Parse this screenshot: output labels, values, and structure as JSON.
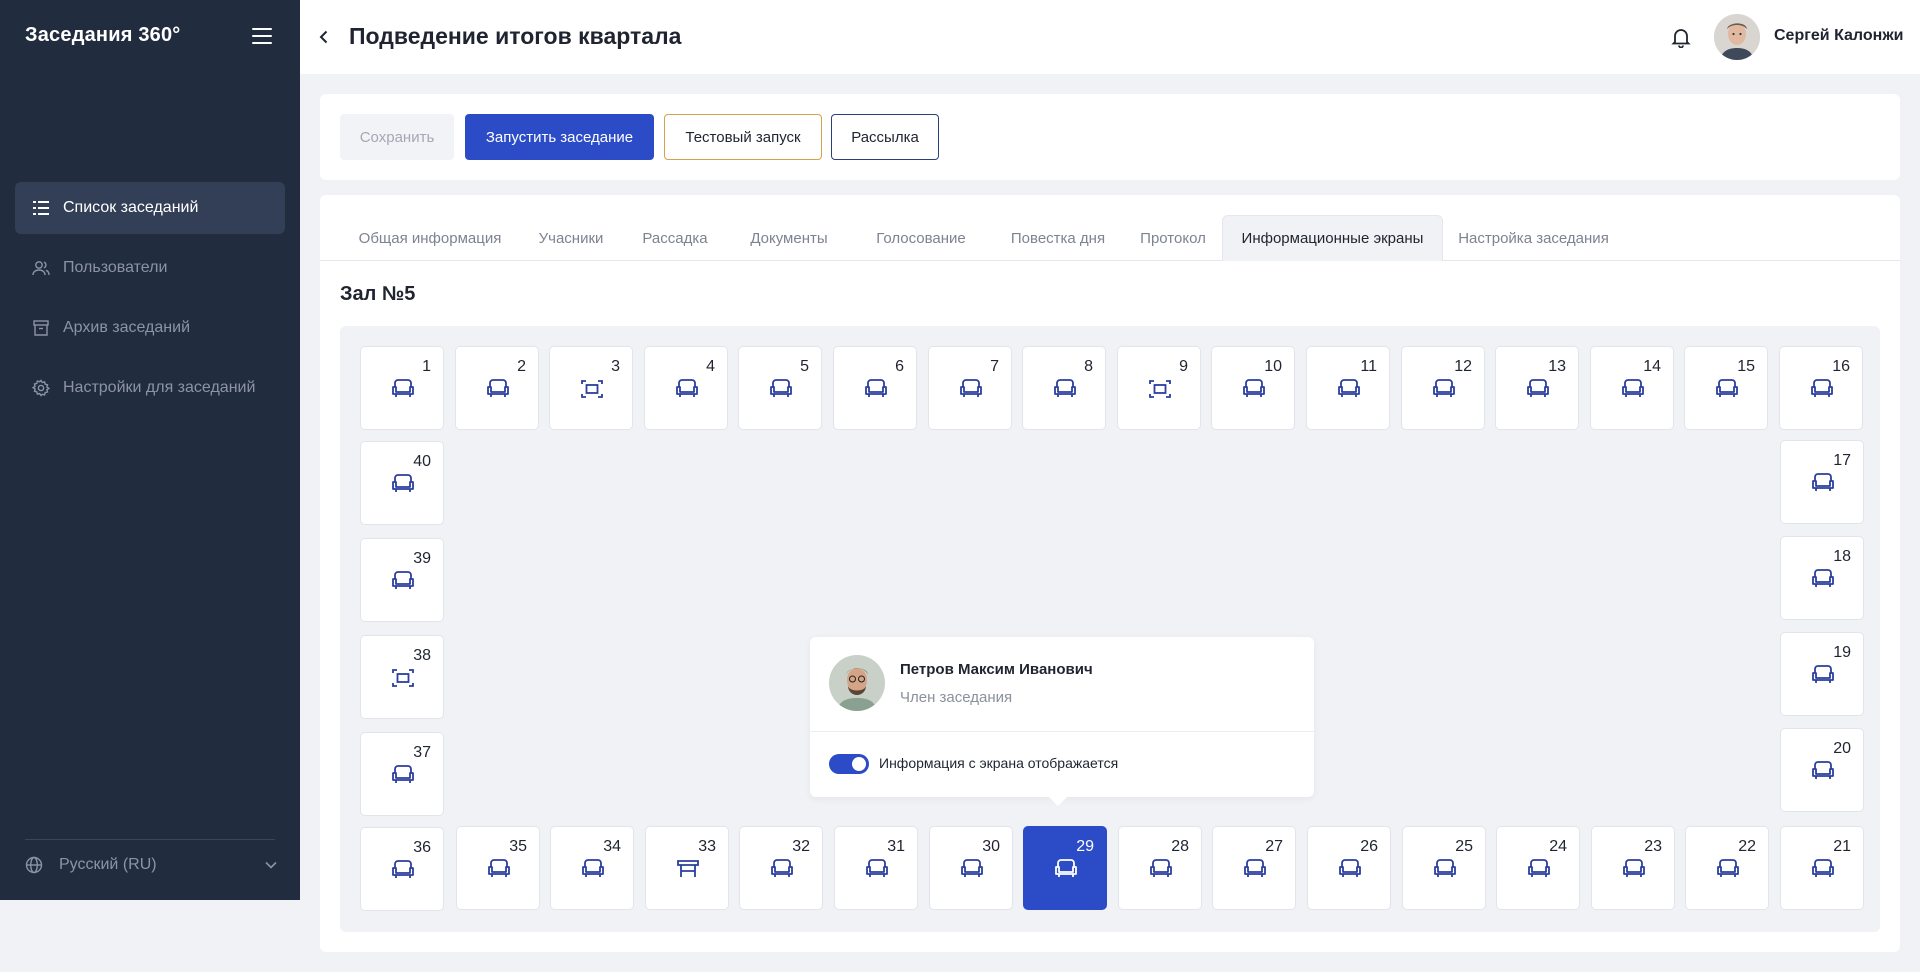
{
  "app": {
    "brand": "Заседания 360°"
  },
  "sidebar": {
    "items": [
      {
        "label": "Список заседаний",
        "icon": "list-icon",
        "active": true
      },
      {
        "label": "Пользователи",
        "icon": "users-icon",
        "active": false
      },
      {
        "label": "Архив заседаний",
        "icon": "archive-icon",
        "active": false
      },
      {
        "label": "Настройки для заседаний",
        "icon": "gear-icon",
        "active": false
      }
    ],
    "language": "Русский (RU)"
  },
  "header": {
    "title": "Подведение итогов квартала",
    "user_name": "Сергей Калонжи"
  },
  "toolbar": {
    "save_label": "Сохранить",
    "start_label": "Запустить заседание",
    "test_label": "Тестовый запуск",
    "mailing_label": "Рассылка"
  },
  "tabs": [
    {
      "label": "Общая информация",
      "active": false
    },
    {
      "label": "Учасники",
      "active": false
    },
    {
      "label": "Рассадка",
      "active": false
    },
    {
      "label": "Документы",
      "active": false
    },
    {
      "label": "Голосование",
      "active": false
    },
    {
      "label": "Повестка дня",
      "active": false
    },
    {
      "label": "Протокол",
      "active": false
    },
    {
      "label": "Информационные экраны",
      "active": true
    },
    {
      "label": "Настройка заседания",
      "active": false
    }
  ],
  "hall": {
    "title": "Зал №5",
    "seats": [
      {
        "num": "1",
        "type": "armchair"
      },
      {
        "num": "2",
        "type": "armchair"
      },
      {
        "num": "3",
        "type": "screen"
      },
      {
        "num": "4",
        "type": "armchair"
      },
      {
        "num": "5",
        "type": "armchair"
      },
      {
        "num": "6",
        "type": "armchair"
      },
      {
        "num": "7",
        "type": "armchair"
      },
      {
        "num": "8",
        "type": "armchair"
      },
      {
        "num": "9",
        "type": "screen"
      },
      {
        "num": "10",
        "type": "armchair"
      },
      {
        "num": "11",
        "type": "armchair"
      },
      {
        "num": "12",
        "type": "armchair"
      },
      {
        "num": "13",
        "type": "armchair"
      },
      {
        "num": "14",
        "type": "armchair"
      },
      {
        "num": "15",
        "type": "armchair"
      },
      {
        "num": "16",
        "type": "armchair"
      },
      {
        "num": "17",
        "type": "armchair"
      },
      {
        "num": "18",
        "type": "armchair"
      },
      {
        "num": "19",
        "type": "armchair"
      },
      {
        "num": "20",
        "type": "armchair"
      },
      {
        "num": "21",
        "type": "armchair"
      },
      {
        "num": "22",
        "type": "armchair"
      },
      {
        "num": "23",
        "type": "armchair"
      },
      {
        "num": "24",
        "type": "armchair"
      },
      {
        "num": "25",
        "type": "armchair"
      },
      {
        "num": "26",
        "type": "armchair"
      },
      {
        "num": "27",
        "type": "armchair"
      },
      {
        "num": "28",
        "type": "armchair"
      },
      {
        "num": "29",
        "type": "armchair",
        "selected": true
      },
      {
        "num": "30",
        "type": "armchair"
      },
      {
        "num": "31",
        "type": "armchair"
      },
      {
        "num": "32",
        "type": "armchair"
      },
      {
        "num": "33",
        "type": "table"
      },
      {
        "num": "34",
        "type": "armchair"
      },
      {
        "num": "35",
        "type": "armchair"
      },
      {
        "num": "36",
        "type": "armchair"
      },
      {
        "num": "37",
        "type": "armchair"
      },
      {
        "num": "38",
        "type": "screen"
      },
      {
        "num": "39",
        "type": "armchair"
      },
      {
        "num": "40",
        "type": "armchair"
      }
    ]
  },
  "popover": {
    "name": "Петров Максим Иванович",
    "role": "Член заседания",
    "toggle_label": "Информация с экрана отображается",
    "toggle_on": true
  },
  "colors": {
    "sidebar_bg": "#222c3f",
    "accent": "#2c4cc7",
    "icon_blue": "#2a3f9e",
    "test_border": "#d4a24b"
  }
}
